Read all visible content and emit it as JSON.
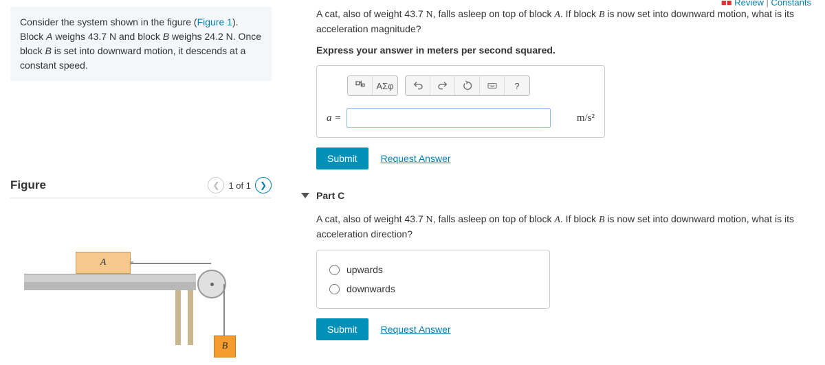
{
  "top_nav": {
    "review": "Review",
    "constants": "Constants"
  },
  "problem": {
    "prefix": "Consider the system shown in the figure (",
    "figlink": "Figure 1",
    "suffix": "). Block ",
    "a_label": "A",
    "mid1": " weighs 43.7 ",
    "n1": "N",
    "mid2": " and block ",
    "b_label": "B",
    "mid3": " weighs 24.2 ",
    "n2": "N",
    "mid4": ". Once block ",
    "b_label2": "B",
    "tail": " is set into downward motion, it descends at a constant speed."
  },
  "figure": {
    "title": "Figure",
    "count": "1 of 1",
    "blockA": "A",
    "blockB": "B"
  },
  "partB": {
    "q1": "A cat, also of weight 43.7 ",
    "n": "N",
    "q2": ", falls asleep on top of block ",
    "a": "A",
    "q3": ". If block ",
    "b": "B",
    "q4": " is now set into downward motion, what is its acceleration magnitude?",
    "instruction": "Express your answer in meters per second squared.",
    "var_label": "a =",
    "unit": "m/s²",
    "submit": "Submit",
    "request": "Request Answer",
    "toolbar": {
      "templates": "▯√▯",
      "greek": "ΑΣφ",
      "help": "?"
    },
    "input_value": ""
  },
  "partC": {
    "title": "Part C",
    "q1": "A cat, also of weight 43.7 ",
    "n": "N",
    "q2": ", falls asleep on top of block ",
    "a": "A",
    "q3": ". If block ",
    "b": "B",
    "q4": " is now set into downward motion, what is its acceleration direction?",
    "opt1": "upwards",
    "opt2": "downwards",
    "submit": "Submit",
    "request": "Request Answer"
  }
}
